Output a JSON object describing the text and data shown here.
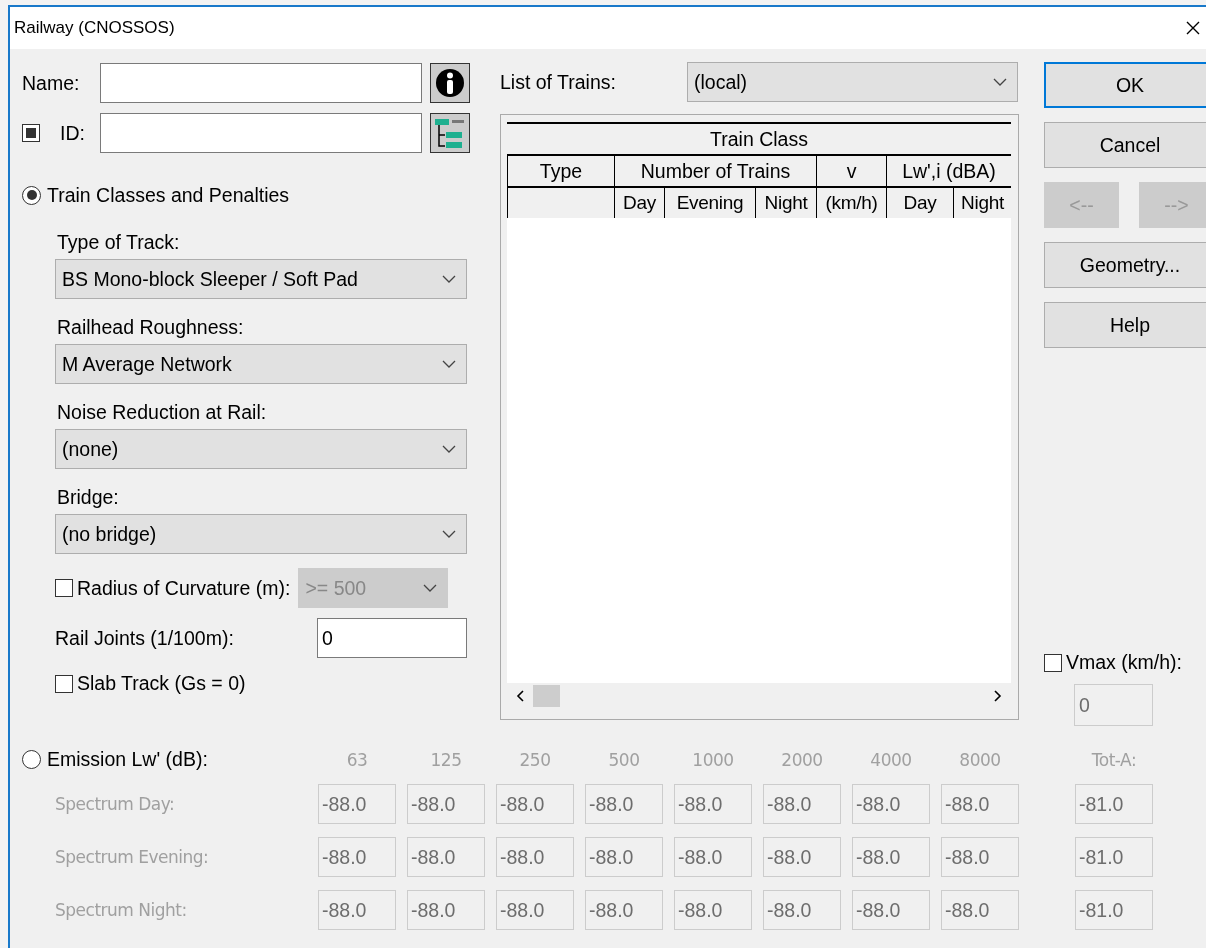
{
  "window": {
    "title": "Railway (CNOSSOS)"
  },
  "name_field": {
    "label": "Name:"
  },
  "id_field": {
    "label": "ID:",
    "checked": true
  },
  "mode_options": [
    {
      "label": "Train Classes and Penalties",
      "selected": true
    },
    {
      "label": "Emission Lw' (dB):",
      "selected": false
    }
  ],
  "track_settings": [
    {
      "label": "Type of Track:",
      "value": "BS Mono-block Sleeper / Soft Pad"
    },
    {
      "label": "Railhead Roughness:",
      "value": "M Average Network"
    },
    {
      "label": "Noise Reduction at Rail:",
      "value": "(none)"
    },
    {
      "label": "Bridge:",
      "value": "(no bridge)"
    }
  ],
  "radius": {
    "label": "Radius of Curvature (m):",
    "checked": false,
    "value": ">= 500",
    "disabled": true
  },
  "rail_joints": {
    "label": "Rail Joints (1/100m):",
    "value": "0"
  },
  "slab_track": {
    "label": "Slab Track (Gs = 0)",
    "checked": false
  },
  "train_list": {
    "label": "List of Trains:",
    "value": "(local)"
  },
  "train_table": {
    "title": "Train Class",
    "groups": [
      {
        "label": "Type"
      },
      {
        "label": "Number of Trains",
        "subheaders": [
          "Day",
          "Evening",
          "Night"
        ]
      },
      {
        "label": "v",
        "subheaders": [
          "(km/h)"
        ]
      },
      {
        "label": "Lw',i (dBA)",
        "subheaders": [
          "Day",
          "Night"
        ]
      }
    ]
  },
  "buttons": [
    {
      "label": "OK",
      "kind": "wide",
      "default": true,
      "disabled": false
    },
    {
      "label": "Cancel",
      "kind": "wide",
      "default": false,
      "disabled": false
    },
    {
      "label": "<--",
      "kind": "half",
      "default": false,
      "disabled": true
    },
    {
      "label": "-->",
      "kind": "half",
      "default": false,
      "disabled": true
    },
    {
      "label": "Geometry...",
      "kind": "wide",
      "default": false,
      "disabled": false
    },
    {
      "label": "Help",
      "kind": "wide",
      "default": false,
      "disabled": false
    }
  ],
  "vmax": {
    "label": "Vmax (km/h):",
    "checked": false,
    "value": "0",
    "disabled": true
  },
  "emission": {
    "disabled": true,
    "frequencies": [
      "63",
      "125",
      "250",
      "500",
      "1000",
      "2000",
      "4000",
      "8000"
    ],
    "total_label": "Tot-A:",
    "rows": [
      {
        "label": "Spectrum Day:",
        "values": [
          "-88.0",
          "-88.0",
          "-88.0",
          "-88.0",
          "-88.0",
          "-88.0",
          "-88.0",
          "-88.0"
        ],
        "total": "-81.0"
      },
      {
        "label": "Spectrum Evening:",
        "values": [
          "-88.0",
          "-88.0",
          "-88.0",
          "-88.0",
          "-88.0",
          "-88.0",
          "-88.0",
          "-88.0"
        ],
        "total": "-81.0"
      },
      {
        "label": "Spectrum Night:",
        "values": [
          "-88.0",
          "-88.0",
          "-88.0",
          "-88.0",
          "-88.0",
          "-88.0",
          "-88.0",
          "-88.0"
        ],
        "total": "-81.0"
      }
    ]
  }
}
